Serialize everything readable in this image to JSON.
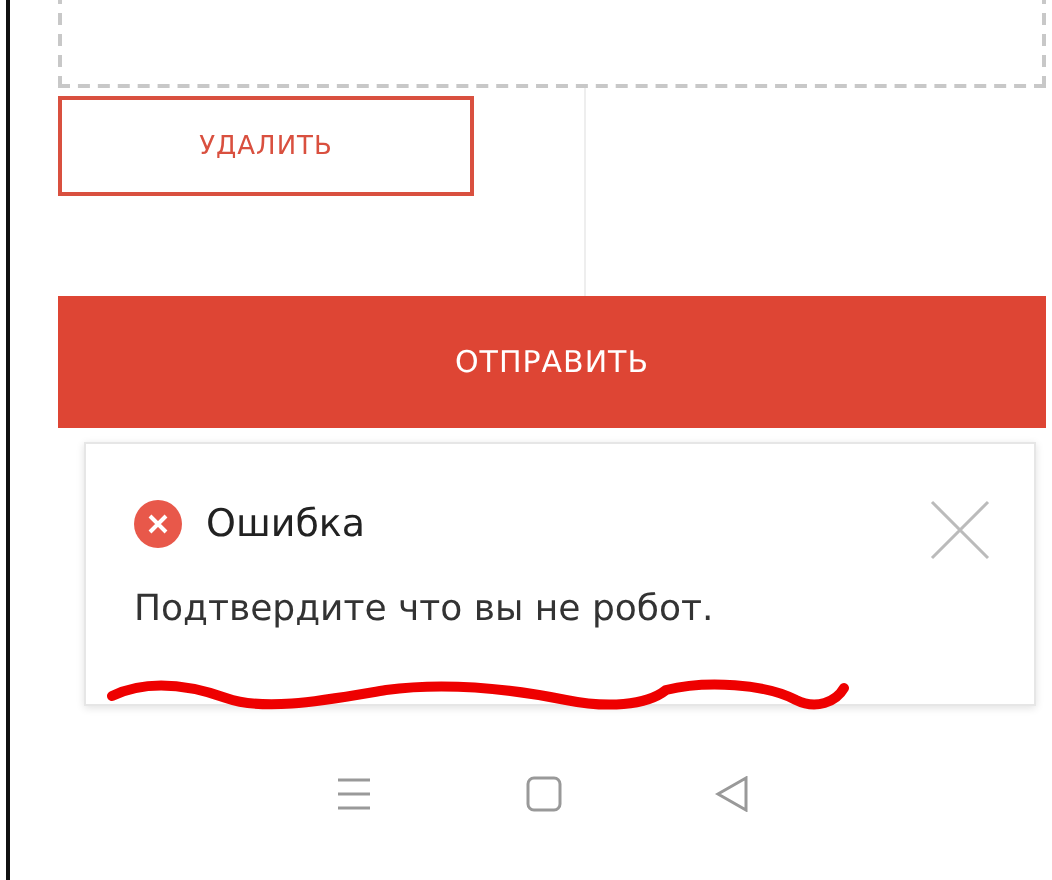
{
  "delete_button": {
    "label": "УДАЛИТЬ"
  },
  "send_button": {
    "label": "ОТПРАВИТЬ"
  },
  "toast": {
    "kind": "error",
    "title": "Ошибка",
    "message": "Подтвердите что вы не робот."
  }
}
